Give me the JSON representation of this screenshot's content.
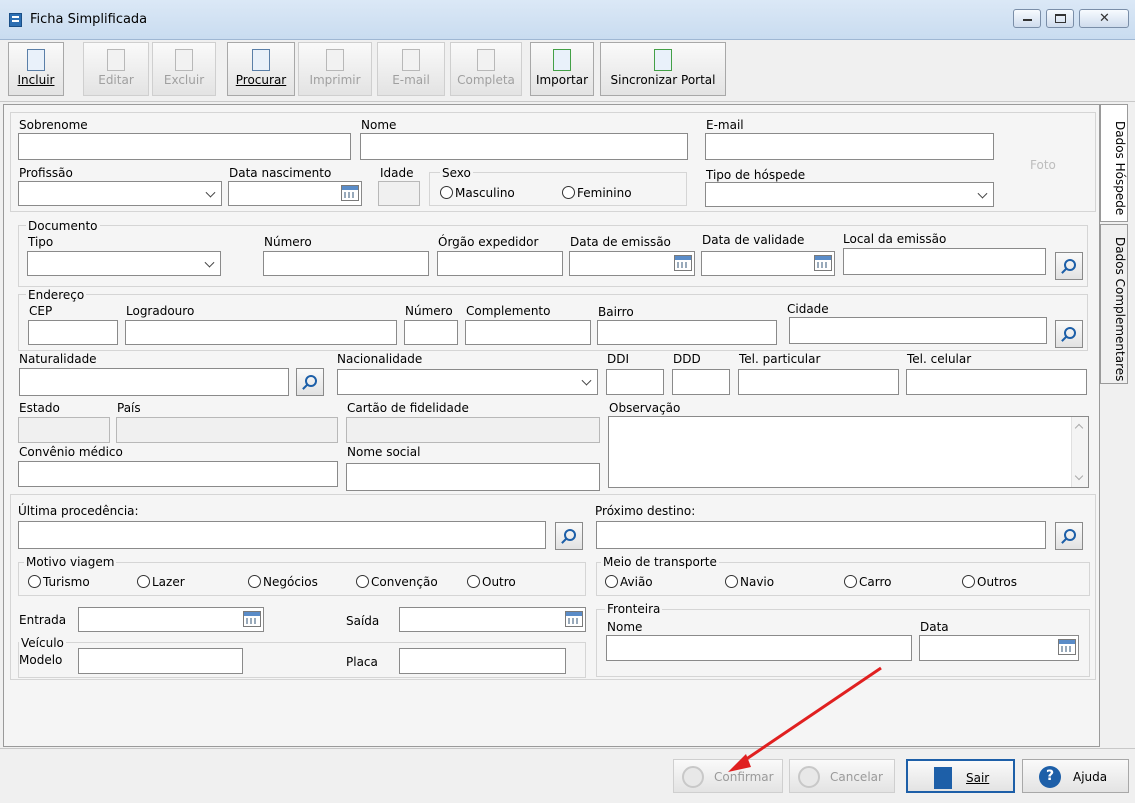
{
  "window": {
    "title": "Ficha Simplificada"
  },
  "toolbar": {
    "incluir": "Incluir",
    "editar": "Editar",
    "excluir": "Excluir",
    "procurar": "Procurar",
    "imprimir": "Imprimir",
    "email": "E-mail",
    "completa": "Completa",
    "importar": "Importar",
    "sincronizar": "Sincronizar Portal"
  },
  "tabs": {
    "dados_hospede": "Dados Hóspede",
    "dados_complementares": "Dados Complementares"
  },
  "personal": {
    "sobrenome": "Sobrenome",
    "nome": "Nome",
    "email": "E-mail",
    "foto": "Foto",
    "profissao": "Profissão",
    "data_nascimento": "Data nascimento",
    "idade": "Idade",
    "sexo": "Sexo",
    "masculino": "Masculino",
    "feminino": "Feminino",
    "tipo_hospede": "Tipo de hóspede"
  },
  "documento": {
    "title": "Documento",
    "tipo": "Tipo",
    "numero": "Número",
    "orgao": "Órgão expedidor",
    "data_emissao": "Data de emissão",
    "data_validade": "Data de validade",
    "local_emissao": "Local da emissão"
  },
  "endereco": {
    "title": "Endereço",
    "cep": "CEP",
    "logradouro": "Logradouro",
    "numero": "Número",
    "complemento": "Complemento",
    "bairro": "Bairro",
    "cidade": "Cidade"
  },
  "contato": {
    "naturalidade": "Naturalidade",
    "nacionalidade": "Nacionalidade",
    "ddi": "DDI",
    "ddd": "DDD",
    "tel_particular": "Tel. particular",
    "tel_celular": "Tel. celular",
    "estado": "Estado",
    "pais": "País",
    "cartao": "Cartão de fidelidade",
    "observacao": "Observação",
    "convenio": "Convênio médico",
    "nome_social": "Nome social"
  },
  "viagem": {
    "ultima_procedencia": "Última procedência:",
    "proximo_destino": "Próximo destino:",
    "motivo_title": "Motivo viagem",
    "motivos": [
      "Turismo",
      "Lazer",
      "Negócios",
      "Convenção",
      "Outro"
    ],
    "meio_title": "Meio de transporte",
    "meios": [
      "Avião",
      "Navio",
      "Carro",
      "Outros"
    ],
    "entrada": "Entrada",
    "saida": "Saída",
    "veiculo": "Veículo",
    "modelo": "Modelo",
    "placa": "Placa",
    "fronteira": "Fronteira",
    "fronteira_nome": "Nome",
    "fronteira_data": "Data"
  },
  "footer": {
    "confirmar": "Confirmar",
    "cancelar": "Cancelar",
    "sair": "Sair",
    "ajuda": "Ajuda"
  },
  "colors": {
    "accent": "#1d5fa8",
    "annotation_arrow": "#e02020"
  }
}
